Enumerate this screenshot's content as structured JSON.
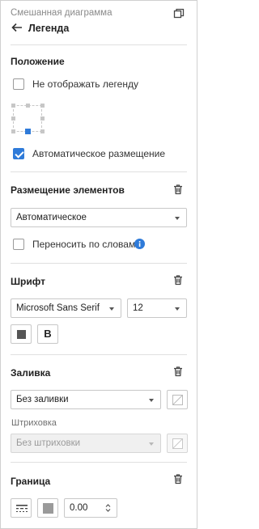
{
  "header": {
    "subtitle": "Смешанная диаграмма",
    "title": "Легенда"
  },
  "position_section": {
    "title": "Положение",
    "hide_legend_label": "Не отображать легенду",
    "hide_legend_checked": false,
    "selected_position": "bottom-center",
    "auto_placement_label": "Автоматическое размещение",
    "auto_placement_checked": true
  },
  "placement_section": {
    "title": "Размещение элементов",
    "placement_value": "Автоматическое",
    "wrap_words_label": "Переносить по словам",
    "wrap_words_checked": false
  },
  "font_section": {
    "title": "Шрифт",
    "font_family_value": "Microsoft Sans Serif",
    "font_size_value": "12",
    "bold_label": "B",
    "color": "#555555"
  },
  "fill_section": {
    "title": "Заливка",
    "fill_value": "Без заливки",
    "hatch_label": "Штриховка",
    "hatch_value": "Без штриховки"
  },
  "border_section": {
    "title": "Граница",
    "width_value": "0.00",
    "color": "#9a9a9a"
  },
  "colors": {
    "accent": "#2f7bd9",
    "divider": "#e0e0e0",
    "trash_icon": "#444444"
  }
}
